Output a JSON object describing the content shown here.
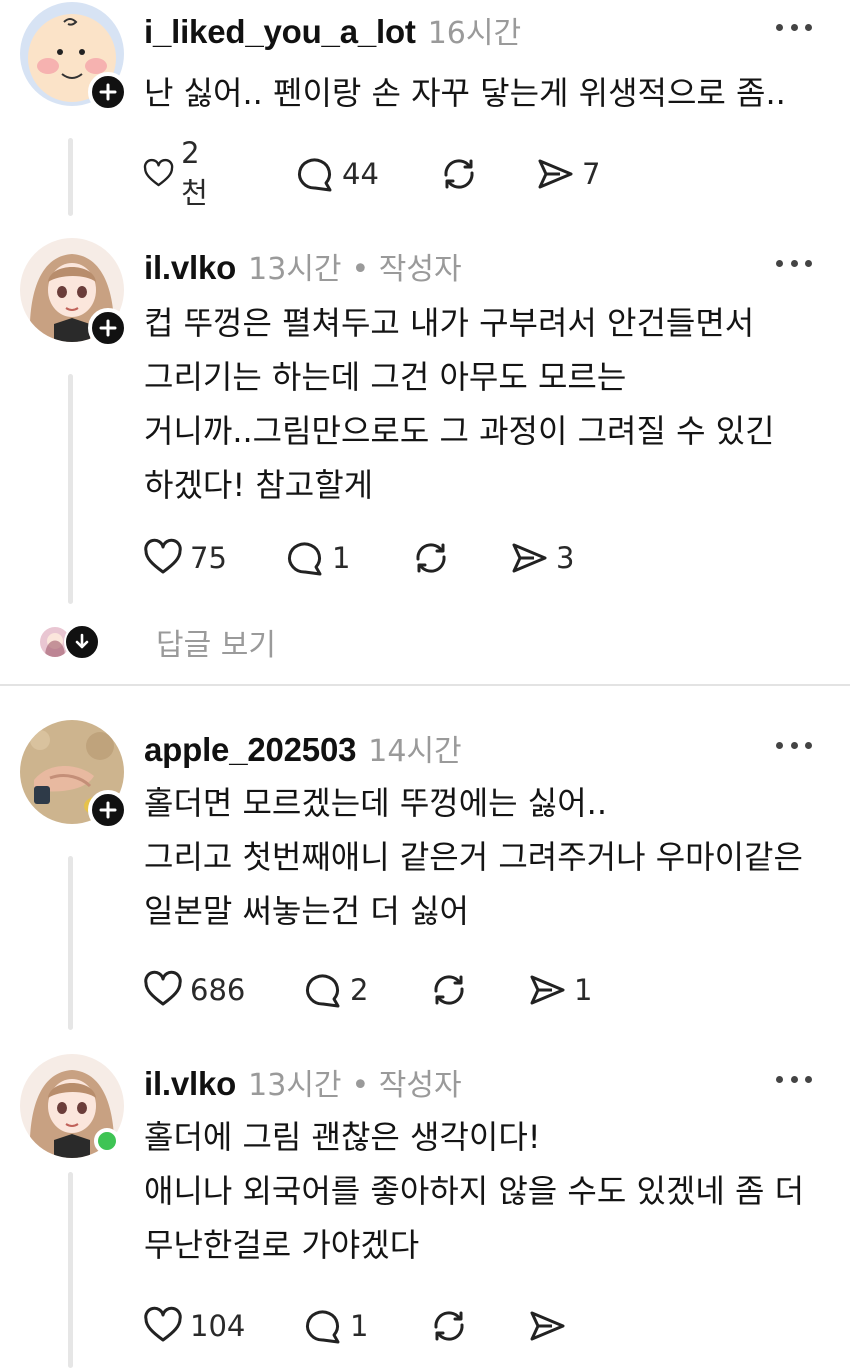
{
  "posts": [
    {
      "username": "i_liked_you_a_lot",
      "time": "16시간",
      "author_tag": "",
      "lines": [
        "난 싫어.. 펜이랑 손 자꾸 닿는게 위생적으로 좀.."
      ],
      "likes": "2천",
      "comments": "44",
      "shares": "7",
      "avatar": "charlie-brown-avatar",
      "badge": "plus"
    },
    {
      "username": "il.vlko",
      "time": "13시간",
      "author_tag": "• 작성자",
      "lines": [
        "컵 뚜껑은 펼쳐두고 내가 구부려서 안건들면서",
        "그리기는 하는데 그건 아무도 모르는",
        "거니까..그림만으로도 그 과정이 그려질 수 있긴",
        "하겠다! 참고할게"
      ],
      "likes": "75",
      "comments": "1",
      "shares": "3",
      "avatar": "anime-girl-avatar",
      "badge": "plus"
    },
    {
      "username": "apple_202503",
      "time": "14시간",
      "author_tag": "",
      "lines": [
        "홀더면 모르겠는데 뚜껑에는 싫어..",
        "그리고 첫번째애니 같은거 그려주거나 우마이같은",
        "일본말 써놓는건 더 싫어"
      ],
      "likes": "686",
      "comments": "2",
      "shares": "1",
      "avatar": "hands-photo-avatar",
      "badge": "plus"
    },
    {
      "username": "il.vlko",
      "time": "13시간",
      "author_tag": "• 작성자",
      "lines": [
        "홀더에 그림 괜찮은 생각이다!",
        "애니나 외국어를 좋아하지 않을 수도 있겠네 좀 더",
        "무난한걸로 가야겠다"
      ],
      "likes": "104",
      "comments": "1",
      "shares": "",
      "avatar": "anime-girl-avatar",
      "badge": "online"
    }
  ],
  "view_replies_label": "답글 보기",
  "colors": {
    "online": "#3ec454",
    "muted": "#9a9a9a",
    "divider": "#e3e3e3"
  }
}
